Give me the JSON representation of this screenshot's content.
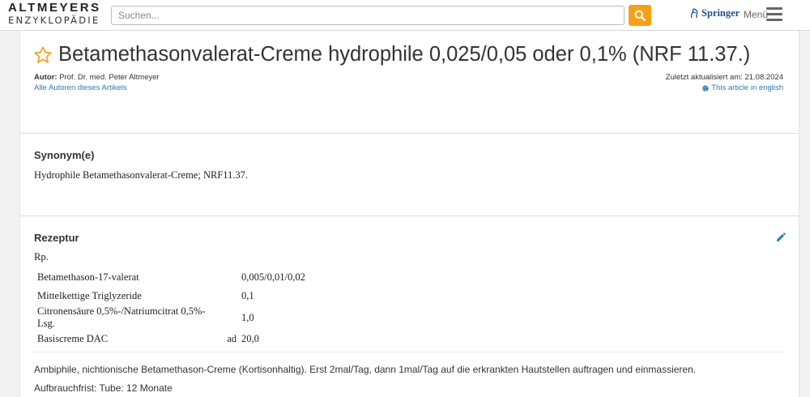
{
  "header": {
    "logo_top": "ALTMEYERS",
    "logo_bottom": "ENZYKLOPÄDIE",
    "search_placeholder": "Suchen...",
    "search_icon": "search-icon",
    "springer_label": "Springer",
    "menu_label": "Menü",
    "accent_color": "#f5a116"
  },
  "article": {
    "title": "Betamethasonvalerat-Creme hydrophile 0,025/0,05 oder 0,1% (NRF 11.37.)",
    "author_prefix": "Autor:",
    "author_name": "Prof. Dr. med. Peter Altmeyer",
    "all_authors_link": "Alle Autoren dieses Artikels",
    "updated": "Zuletzt aktualisiert am: 21.08.2024",
    "english_link": "This article in english",
    "link_color": "#2a7ab8"
  },
  "synonyms": {
    "heading": "Synonym(e)",
    "text": "Hydrophile Betamethasonvalerat-Creme; NRF11.37."
  },
  "rezeptur": {
    "heading": "Rezeptur",
    "rp": "Rp.",
    "rows": [
      {
        "ingredient": "Betamethason-17-valerat",
        "ad": "",
        "amount": "0,005/0,01/0,02"
      },
      {
        "ingredient": "Mittelkettige Triglyzeride",
        "ad": "",
        "amount": "0,1"
      },
      {
        "ingredient": "Citronensäure 0,5%-/Natriumcitrat 0,5%-Lsg.",
        "ad": "",
        "amount": "1,0"
      },
      {
        "ingredient": "Basiscreme DAC",
        "ad": "ad",
        "amount": "20,0"
      }
    ],
    "description": "Ambiphile, nichtionische Betamethason-Creme (Kortisonhaltig). Erst 2mal/Tag, dann 1mal/Tag auf die erkrankten Hautstellen auftragen und einmassieren.",
    "shelf_life": "Aufbrauchfrist: Tube: 12 Monate"
  }
}
